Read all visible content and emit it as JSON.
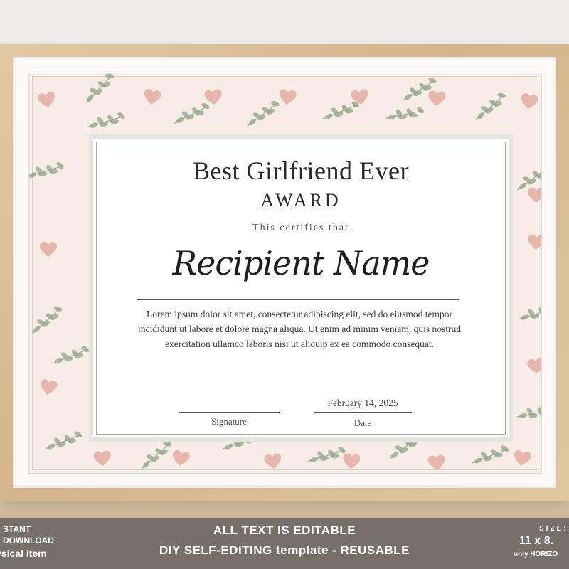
{
  "certificate": {
    "title": "Best Girlfriend Ever",
    "subtitle": "AWARD",
    "certifies": "This certifies that",
    "recipient": "Recipient Name",
    "body": "Lorem ipsum dolor sit amet, consectetur adipiscing elit, sed do eiusmod tempor incididunt ut labore et dolore magna aliqua. Ut enim ad minim veniam, quis nostrud exercitation ullamco laboris nisi ut aliquip ex ea commodo consequat.",
    "signature_label": "Signature",
    "date_value": "February 14, 2025",
    "date_label": "Date"
  },
  "banner": {
    "left_line1": "STANT",
    "left_line2": "DOWNLOAD",
    "left_line3": "ysical item",
    "center_line1": "ALL TEXT IS EDITABLE",
    "center_line2": "DIY SELF-EDITING template - REUSABLE",
    "right_line1": "SIZE:",
    "right_line2": "11 x 8.",
    "right_line3": "only HORIZO"
  },
  "colors": {
    "heart": "#e3aaa0",
    "leaf": "#9aab92",
    "pattern_bg": "#f7ede6",
    "banner_bg": "#767069"
  },
  "decor": {
    "heart_icon": "heart-icon",
    "leaf_icon": "leaf-sprig-icon"
  }
}
